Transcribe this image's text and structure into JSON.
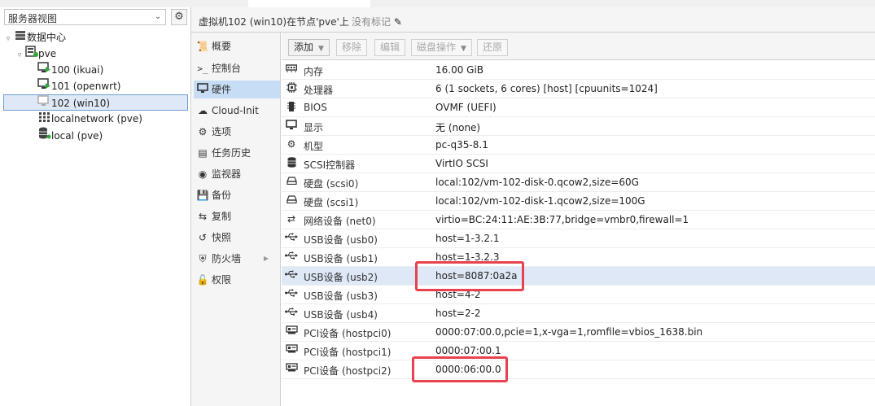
{
  "tree": {
    "view_selector": "服务器视图",
    "nodes": [
      {
        "label": "数据中心",
        "icon": "datacenter-icon"
      },
      {
        "label": "pve",
        "icon": "node-icon"
      },
      {
        "label": "100 (ikuai)",
        "icon": "vm-running-icon"
      },
      {
        "label": "101 (openwrt)",
        "icon": "vm-running-icon"
      },
      {
        "label": "102 (win10)",
        "icon": "vm-stopped-icon"
      },
      {
        "label": "localnetwork (pve)",
        "icon": "sdn-grid-icon"
      },
      {
        "label": "local (pve)",
        "icon": "storage-icon"
      }
    ]
  },
  "header": {
    "title": "虚拟机102 (win10)在节点'pve'上",
    "tags": "没有标记"
  },
  "nav": [
    {
      "label": "概要",
      "icon": "summary-icon"
    },
    {
      "label": "控制台",
      "icon": "console-icon"
    },
    {
      "label": "硬件",
      "icon": "monitor-icon"
    },
    {
      "label": "Cloud-Init",
      "icon": "cloud-icon"
    },
    {
      "label": "选项",
      "icon": "options-gear-icon"
    },
    {
      "label": "任务历史",
      "icon": "task-list-icon"
    },
    {
      "label": "监视器",
      "icon": "eye-icon"
    },
    {
      "label": "备份",
      "icon": "floppy-icon"
    },
    {
      "label": "复制",
      "icon": "retweet-icon"
    },
    {
      "label": "快照",
      "icon": "history-icon"
    },
    {
      "label": "防火墙",
      "icon": "shield-icon"
    },
    {
      "label": "权限",
      "icon": "unlock-icon"
    }
  ],
  "toolbar": {
    "add": "添加",
    "remove": "移除",
    "edit": "编辑",
    "disk_action": "磁盘操作",
    "revert": "还原"
  },
  "hardware": [
    {
      "key": "内存",
      "value": "16.00 GiB",
      "icon": "memory-icon"
    },
    {
      "key": "处理器",
      "value": "6 (1 sockets, 6 cores) [host] [cpuunits=1024]",
      "icon": "cpu-icon"
    },
    {
      "key": "BIOS",
      "value": "OVMF (UEFI)",
      "icon": "bios-icon"
    },
    {
      "key": "显示",
      "value": "无 (none)",
      "icon": "display-icon"
    },
    {
      "key": "机型",
      "value": "pc-q35-8.1",
      "icon": "machine-cogs-icon"
    },
    {
      "key": "SCSI控制器",
      "value": "VirtIO SCSI",
      "icon": "database-icon"
    },
    {
      "key": "硬盘 (scsi0)",
      "value": "local:102/vm-102-disk-0.qcow2,size=60G",
      "icon": "hdd-icon"
    },
    {
      "key": "硬盘 (scsi1)",
      "value": "local:102/vm-102-disk-1.qcow2,size=100G",
      "icon": "hdd-icon"
    },
    {
      "key": "网络设备 (net0)",
      "value": "virtio=BC:24:11:AE:3B:77,bridge=vmbr0,firewall=1",
      "icon": "exchange-icon"
    },
    {
      "key": "USB设备 (usb0)",
      "value": "host=1-3.2.1",
      "icon": "usb-icon"
    },
    {
      "key": "USB设备 (usb1)",
      "value": "host=1-3.2.3",
      "icon": "usb-icon"
    },
    {
      "key": "USB设备 (usb2)",
      "value": "host=8087:0a2a",
      "icon": "usb-icon"
    },
    {
      "key": "USB设备 (usb3)",
      "value": "host=4-2",
      "icon": "usb-icon"
    },
    {
      "key": "USB设备 (usb4)",
      "value": "host=2-2",
      "icon": "usb-icon"
    },
    {
      "key": "PCI设备 (hostpci0)",
      "value": "0000:07:00.0,pcie=1,x-vga=1,romfile=vbios_1638.bin",
      "icon": "pci-card-icon"
    },
    {
      "key": "PCI设备 (hostpci1)",
      "value": "0000:07:00.1",
      "icon": "pci-card-icon"
    },
    {
      "key": "PCI设备 (hostpci2)",
      "value": "0000:06:00.0",
      "icon": "pci-card-icon"
    }
  ],
  "colors": {
    "highlight_box": "#e8424f",
    "selection": "#dfe8f6",
    "nav_active": "#c6ddf5",
    "running_green": "#2eaa3a"
  }
}
